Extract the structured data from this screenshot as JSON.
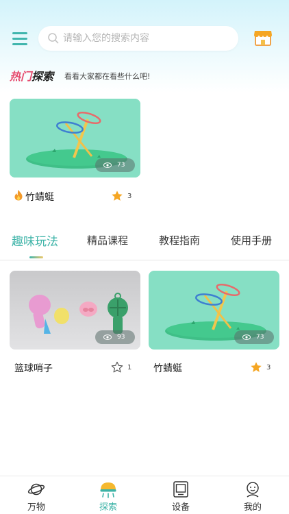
{
  "search": {
    "placeholder": "请输入您的搜索内容"
  },
  "hot": {
    "title_part1": "热门",
    "title_part2": "探索",
    "subtitle": "看看大家都在看些什么吧!",
    "card": {
      "title": "竹蜻蜓",
      "views": "73",
      "stars": "3"
    }
  },
  "tabs": [
    {
      "label": "趣味玩法"
    },
    {
      "label": "精品课程"
    },
    {
      "label": "教程指南"
    },
    {
      "label": "使用手册"
    }
  ],
  "cards": [
    {
      "title": "篮球哨子",
      "views": "93",
      "stars": "1",
      "starred": false
    },
    {
      "title": "竹蜻蜓",
      "views": "73",
      "stars": "3",
      "starred": true
    }
  ],
  "nav": [
    {
      "label": "万物",
      "icon": "planet-icon"
    },
    {
      "label": "探索",
      "icon": "explore-icon"
    },
    {
      "label": "设备",
      "icon": "device-icon"
    },
    {
      "label": "我的",
      "icon": "profile-icon"
    }
  ],
  "colors": {
    "accent": "#3cb3a7",
    "hot": "#e64a6e",
    "star": "#f5a623"
  }
}
